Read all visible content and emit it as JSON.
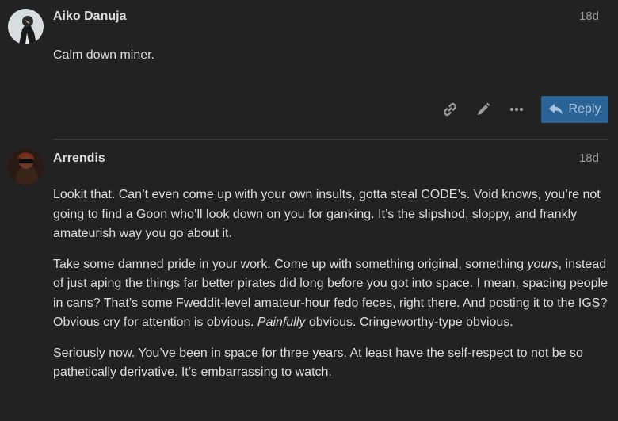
{
  "posts": [
    {
      "username": "Aiko Danuja",
      "date": "18d",
      "paragraphs": [
        "Calm down miner."
      ],
      "reply_label": "Reply",
      "actions": [
        "link-icon",
        "pencil-icon",
        "ellipsis-icon"
      ]
    },
    {
      "username": "Arrendis",
      "date": "18d",
      "p1": "Lookit that. Can’t even come up with your own insults, gotta steal CODE’s. Void knows, you’re not going to find a Goon who’ll look down on you for ganking. It’s the slipshod, sloppy, and frankly amateurish way you go about it.",
      "p2_a": "Take some damned pride in your work. Come up with something original, something ",
      "p2_em1": "yours",
      "p2_b": ", instead of just aping the things far better pirates did long before you got into space. I mean, spacing people in cans? That’s some Fweddit-level amateur-hour fedo feces, right there. And posting it to the IGS? Obvious cry for attention is obvious. ",
      "p2_em2": "Painfully",
      "p2_c": " obvious. Cringeworthy-type obvious.",
      "p3": "Seriously now. You’ve been in space for three years. At least have the self-respect to not be so pathetically derivative. It’s embarrassing to watch."
    }
  ],
  "colors": {
    "background": "#222222",
    "text": "#dddddd",
    "muted": "#9a9a9a",
    "reply_bg": "#2a6496"
  }
}
